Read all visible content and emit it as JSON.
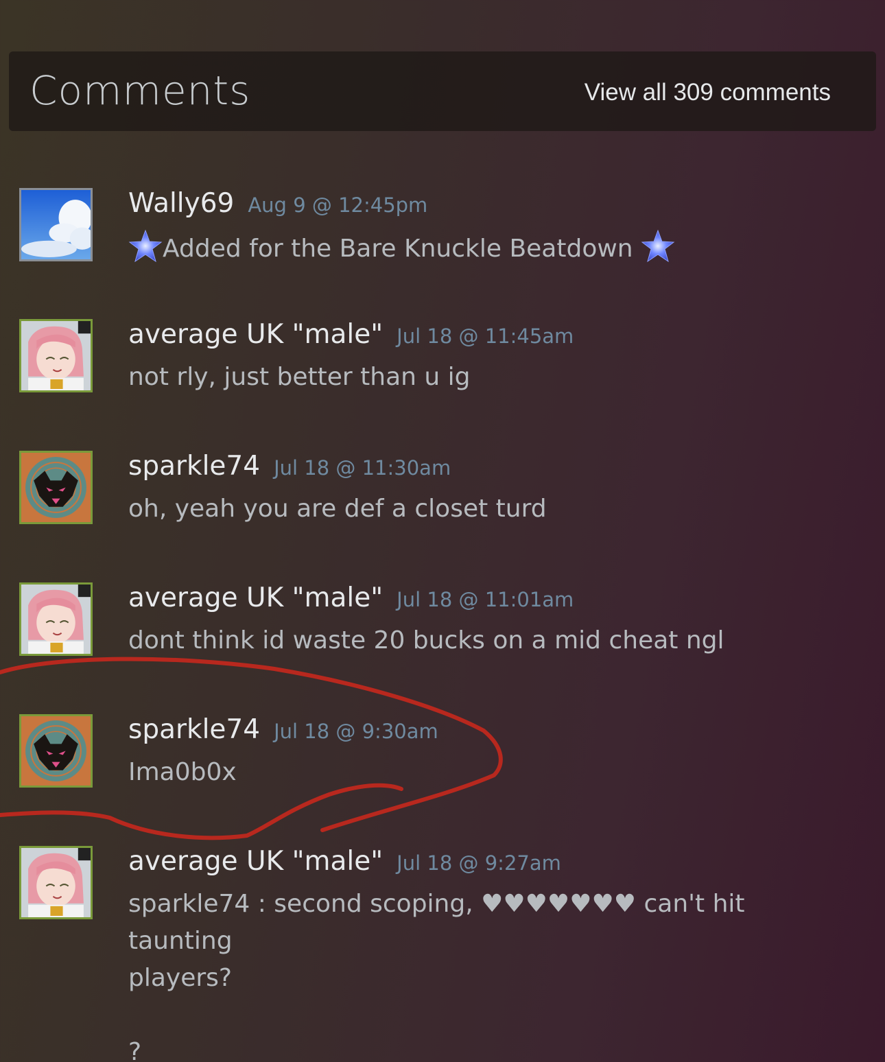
{
  "header": {
    "title": "Comments",
    "view_all": "View all 309 comments"
  },
  "comments": [
    {
      "author": "Wally69",
      "time": "Aug 9 @ 12:45pm",
      "text": "Added for the Bare Knuckle Beatdown",
      "avatar": "sky-clouds-avatar"
    },
    {
      "author": "average UK \"male\"",
      "time": "Jul 18 @ 11:45am",
      "text": "not rly, just better than u ig",
      "avatar": "anime-pink-hair-avatar"
    },
    {
      "author": "sparkle74",
      "time": "Jul 18 @ 11:30am",
      "text": "oh, yeah you are def a closet turd",
      "avatar": "wolf-emblem-avatar"
    },
    {
      "author": "average UK \"male\"",
      "time": "Jul 18 @ 11:01am",
      "text": "dont think id waste 20 bucks on a mid cheat ngl",
      "avatar": "anime-pink-hair-avatar"
    },
    {
      "author": "sparkle74",
      "time": "Jul 18 @ 9:30am",
      "text": "Ima0b0x",
      "avatar": "wolf-emblem-avatar"
    },
    {
      "author": "average UK \"male\"",
      "time": "Jul 18 @ 9:27am",
      "text_line1": "sparkle74 : second scoping, ♥♥♥♥♥♥♥ can't hit taunting",
      "text_line2": "players?",
      "text_line3": "?",
      "avatar": "anime-pink-hair-avatar"
    }
  ],
  "colors": {
    "timestamp": "#6f8aa0",
    "annotation": "#b8281e",
    "avatar_border": "#7a9a3a"
  }
}
